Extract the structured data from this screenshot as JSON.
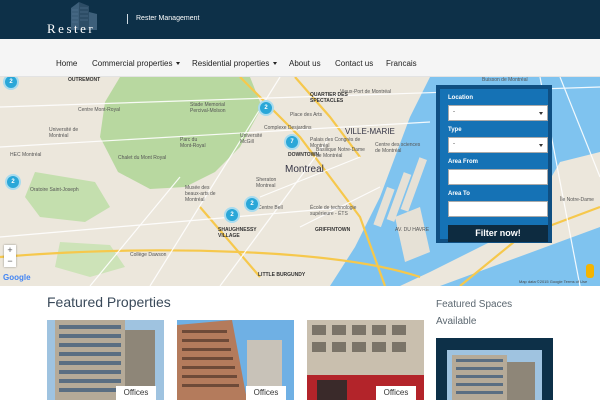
{
  "header": {
    "logo_text": "Rester",
    "company_link": "Rester Management",
    "background": "#0d3048"
  },
  "nav": {
    "items": [
      {
        "label": "Home",
        "dropdown": false
      },
      {
        "label": "Commercial properties",
        "dropdown": true
      },
      {
        "label": "Residential properties",
        "dropdown": true
      },
      {
        "label": "About us",
        "dropdown": false
      },
      {
        "label": "Contact us",
        "dropdown": false
      },
      {
        "label": "Francais",
        "dropdown": false
      }
    ]
  },
  "map": {
    "labels": {
      "outremont": "OUTREMONT",
      "centre_mont_royal": "Centre Mont-Royal",
      "stade": "Stade Memorial Percival-Molson",
      "place_des_arts": "Place des Arts",
      "quartier": "QUARTIER DES SPECTACLES",
      "vieux_port": "Vieux-Port de Montréal",
      "universite_montreal": "Université de Montréal",
      "parc": "Parc du Mont-Royal",
      "complexe": "Complexe Desjardins",
      "ville_marie": "VILLE-MARIE",
      "hec": "HEC Montréal",
      "chalet": "Chalet du Mont Royal",
      "mcgill": "Université McGill",
      "palais": "Palais des Congrès de Montréal",
      "notre_dame": "Basilique Notre-Dame de Montréal",
      "centre_sciences": "Centre des sciences de Montréal",
      "downtown": "DOWNTOWN",
      "montreal": "Montreal",
      "oratoire": "Oratoire Saint-Joseph",
      "musee": "Musée des beaux-arts de Montréal",
      "sheraton": "Sheraton Montreal",
      "centre_bell": "Centre Bell",
      "ecole": "École de technologie supérieure - ÉTS",
      "griffintown": "GRIFFINTOWN",
      "shaughnessy": "SHAUGHNESSY VILLAGE",
      "college": "Collège Dawson",
      "petite_bourgogne": "LITTLE BURGUNDY",
      "ile_notre_dame": "Île Notre-Dame",
      "buisson": "Buisson de Montréal",
      "havre": "AV. DU HAVRE"
    },
    "clusters": [
      {
        "count": "2"
      },
      {
        "count": "7"
      },
      {
        "count": "2"
      },
      {
        "count": "2"
      },
      {
        "count": "2"
      },
      {
        "count": "2"
      }
    ],
    "zoom_in": "+",
    "zoom_out": "−",
    "google": "Google",
    "attribution": "Map data ©2015 Google   Terms of Use"
  },
  "filter": {
    "location_label": "Location",
    "location_value": "-",
    "type_label": "Type",
    "type_value": "-",
    "area_from_label": "Area From",
    "area_to_label": "Area To",
    "button": "Filter now!",
    "panel_color": "#1572b5",
    "button_color": "#0d2b40"
  },
  "featured": {
    "title": "Featured Properties",
    "cards": [
      {
        "tag": "Offices"
      },
      {
        "tag": "Offices"
      },
      {
        "tag": "Offices"
      }
    ]
  },
  "spaces": {
    "title": "Featured Spaces Available"
  }
}
